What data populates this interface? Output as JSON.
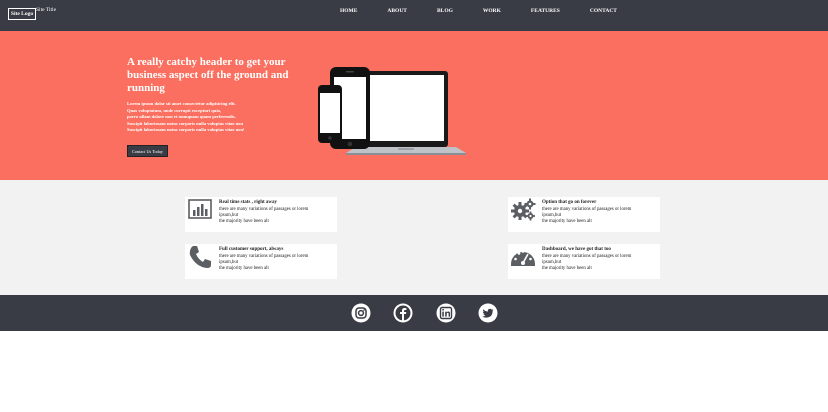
{
  "nav": {
    "logo": "Site Logo",
    "site_title": "Site Title",
    "menu": [
      "HOME",
      "ABOUT",
      "BLOG",
      "WORK",
      "FEATURES",
      "CONTACT"
    ]
  },
  "hero": {
    "heading": "A really catchy header to get your business aspect off the ground and running",
    "lines": [
      "Lorem ipsum dolor sit amet consectetur adipisicing elit.",
      "Quas voluptatum, unde corrupti excepturi quia,",
      "porro ullam dolore non et numquam quam perferendis.",
      "Suscipit laboriosam natus corporis nulla voluptas vitae non",
      "Suscipit laboriosam natus corporis nulla voluptas vitae non!"
    ],
    "button": "Contact Us Today",
    "image": "tablet-phone-laptop-devices"
  },
  "features": [
    {
      "icon": "bar-chart-icon",
      "title": "Real time stats , right away",
      "desc": [
        "there are many variations of passages or lorem",
        "ipsum,but",
        "the majority have been alt"
      ]
    },
    {
      "icon": "gears-icon",
      "title": "Option that go on forever",
      "desc": [
        "there are many variations of passages or lorem",
        "ipsum,but",
        "the majority have been alt"
      ]
    },
    {
      "icon": "phone-icon",
      "title": "Full customer support, always",
      "desc": [
        "there are many variations of passages or lorem",
        "ipsum,but",
        "the majority have been alt"
      ]
    },
    {
      "icon": "dashboard-icon",
      "title": "Dashboard, we have got that too",
      "desc": [
        "there are many variations of passages or lorem",
        "ipsum,but",
        "the majority have been alt"
      ]
    }
  ],
  "footer": {
    "social": [
      "instagram-icon",
      "facebook-icon",
      "linkedin-icon",
      "twitter-icon"
    ]
  },
  "colors": {
    "nav_bg": "#393c44",
    "hero_bg": "#fa6f5f",
    "features_bg": "#f2f2f2",
    "footer_bg": "#393c44"
  }
}
